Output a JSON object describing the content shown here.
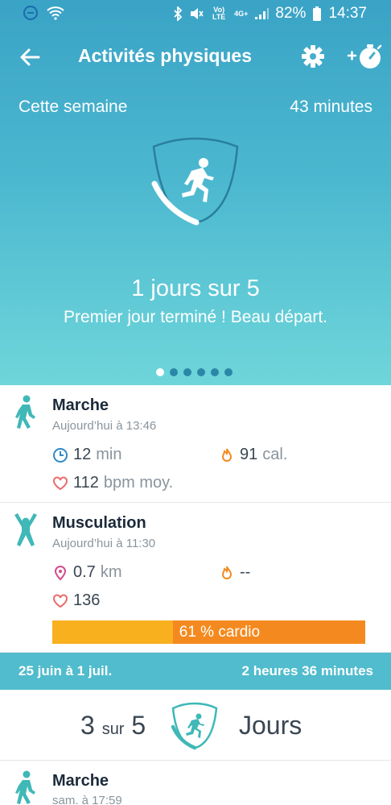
{
  "status": {
    "battery": "82%",
    "time": "14:37",
    "network": "4G+",
    "volte": "Vo) LTE"
  },
  "header": {
    "title": "Activités physiques"
  },
  "week": {
    "label": "Cette semaine",
    "minutes": "43 minutes"
  },
  "goal": {
    "text": "1 jours sur 5",
    "message": "Premier jour terminé ! Beau départ."
  },
  "pager": {
    "count": 6,
    "active": 0
  },
  "activities": [
    {
      "name": "Marche",
      "time": "Aujourd’hui à 13:46",
      "stat1_value": "12",
      "stat1_unit": "min",
      "stat2_value": "91",
      "stat2_unit": "cal.",
      "stat3_value": "112",
      "stat3_unit": "bpm moy."
    },
    {
      "name": "Musculation",
      "time": "Aujourd’hui à 11:30",
      "stat1_value": "0.7",
      "stat1_unit": "km",
      "stat2_value": "--",
      "stat2_unit": "",
      "stat3_value": "136",
      "stat3_unit": "",
      "cardio_label": "61 % cardio",
      "cardio_fraction": 0.385
    },
    {
      "name": "Marche",
      "time": "sam. à 17:59"
    }
  ],
  "weekbar": {
    "range": "25 juin à 1 juil.",
    "total": "2 heures 36 minutes"
  },
  "summary": {
    "count": "3",
    "sep": "sur",
    "goal": "5",
    "unit": "Jours"
  },
  "colors": {
    "accent": "#50bccd",
    "cardio_light": "#f8b01f",
    "cardio_dark": "#f48a1f"
  }
}
